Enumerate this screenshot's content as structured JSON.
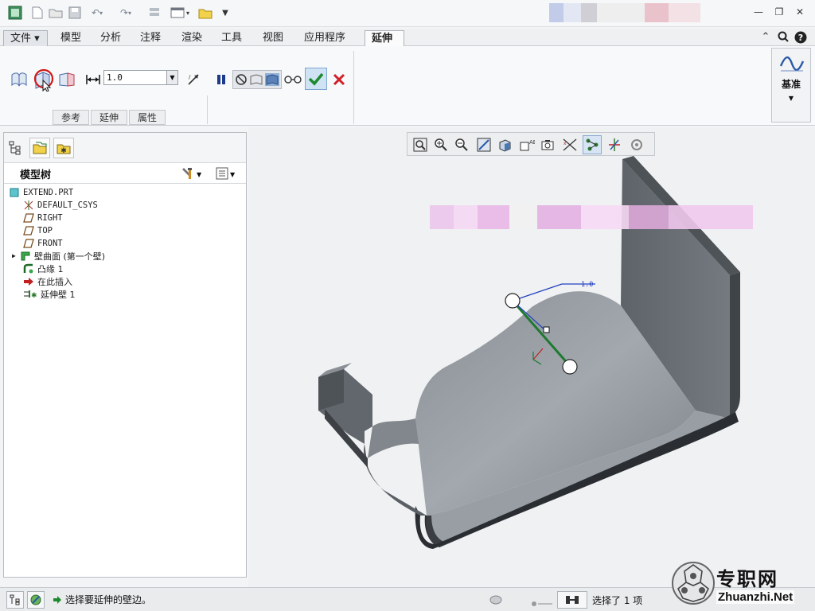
{
  "title_bar": {
    "quick_access": [
      "app-icon",
      "new-icon",
      "open-icon",
      "save-icon",
      "undo-icon",
      "redo-icon",
      "regenerate-icon",
      "windows-icon",
      "folder-icon",
      "customize-icon"
    ],
    "window_controls": [
      "minimize",
      "restore",
      "close"
    ]
  },
  "ribbon": {
    "tabs": [
      "文件 ▾",
      "模型",
      "分析",
      "注释",
      "渲染",
      "工具",
      "视图",
      "应用程序",
      "延伸"
    ],
    "active_tab": "延伸",
    "dimension_value": "1.0",
    "subtabs": [
      "参考",
      "延伸",
      "属性"
    ],
    "datum_label": "基准"
  },
  "model_tree": {
    "title": "模型树",
    "items": [
      {
        "label": "EXTEND.PRT",
        "icon": "part-icon"
      },
      {
        "label": "DEFAULT_CSYS",
        "icon": "csys-icon"
      },
      {
        "label": "RIGHT",
        "icon": "datum-plane-icon"
      },
      {
        "label": "TOP",
        "icon": "datum-plane-icon"
      },
      {
        "label": "FRONT",
        "icon": "datum-plane-icon"
      },
      {
        "label": "壁曲面 (第一个壁)",
        "icon": "wall-icon"
      },
      {
        "label": "凸缘 1",
        "icon": "flange-icon"
      },
      {
        "label": "在此插入",
        "icon": "insert-arrow-icon"
      },
      {
        "label": "延伸壁 1",
        "icon": "extend-wall-icon"
      }
    ]
  },
  "viewport": {
    "dimension_label": "1.0"
  },
  "status_bar": {
    "message": "选择要延伸的壁边。",
    "selection": "选择了 1 项"
  },
  "watermark": {
    "text_cn": "专职网",
    "text_en": "Zhuanzhi.Net"
  },
  "colors": {
    "accent_green": "#1e8a2e",
    "cancel_red": "#d0202a",
    "model_gray": "#8d9399",
    "highlight_blue": "#2040c0"
  }
}
